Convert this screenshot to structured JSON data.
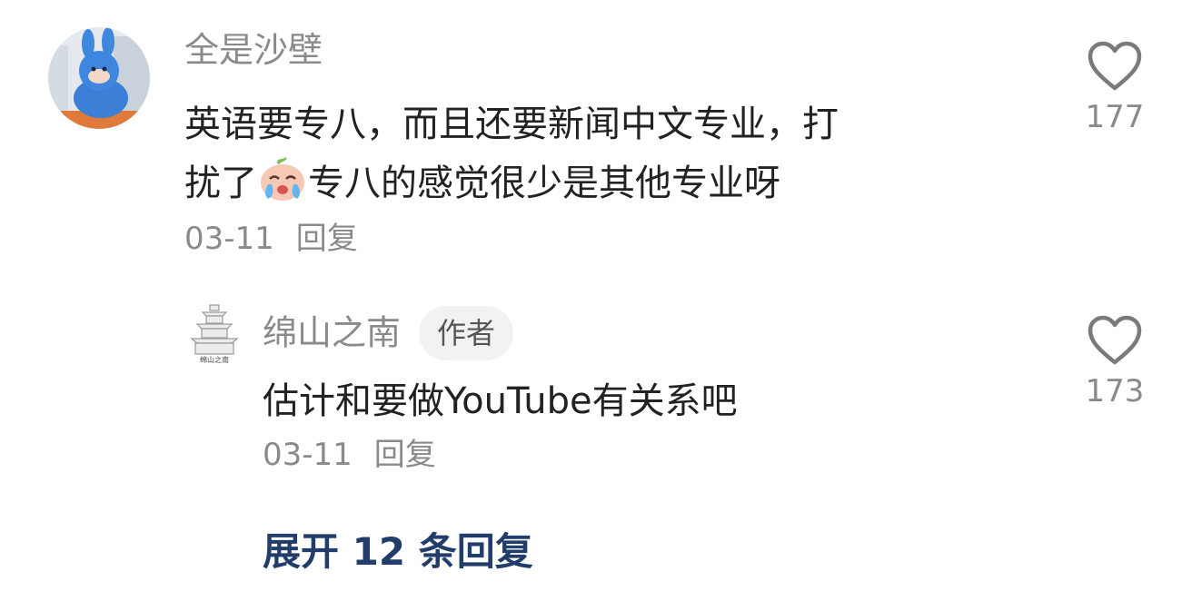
{
  "comment": {
    "user_name": "全是沙壁",
    "text_line1": "英语要专八，而且还要新闻中文专业，打",
    "text_line2_a": "扰了",
    "emoji_icon": "crying-face-icon",
    "text_line2_b": "专八的感觉很少是其他专业呀",
    "date": "03-11",
    "reply_label": "回复",
    "like_count": "177"
  },
  "reply": {
    "user_name": "绵山之南",
    "badge": "作者",
    "avatar_caption": "绵山之南",
    "text": "估计和要做YouTube有关系吧",
    "date": "03-11",
    "reply_label": "回复",
    "like_count": "173"
  },
  "expand": {
    "label": "展开 12 条回复"
  },
  "colors": {
    "link": "#233d6b",
    "muted": "#8a8a8a",
    "text": "#222222"
  }
}
